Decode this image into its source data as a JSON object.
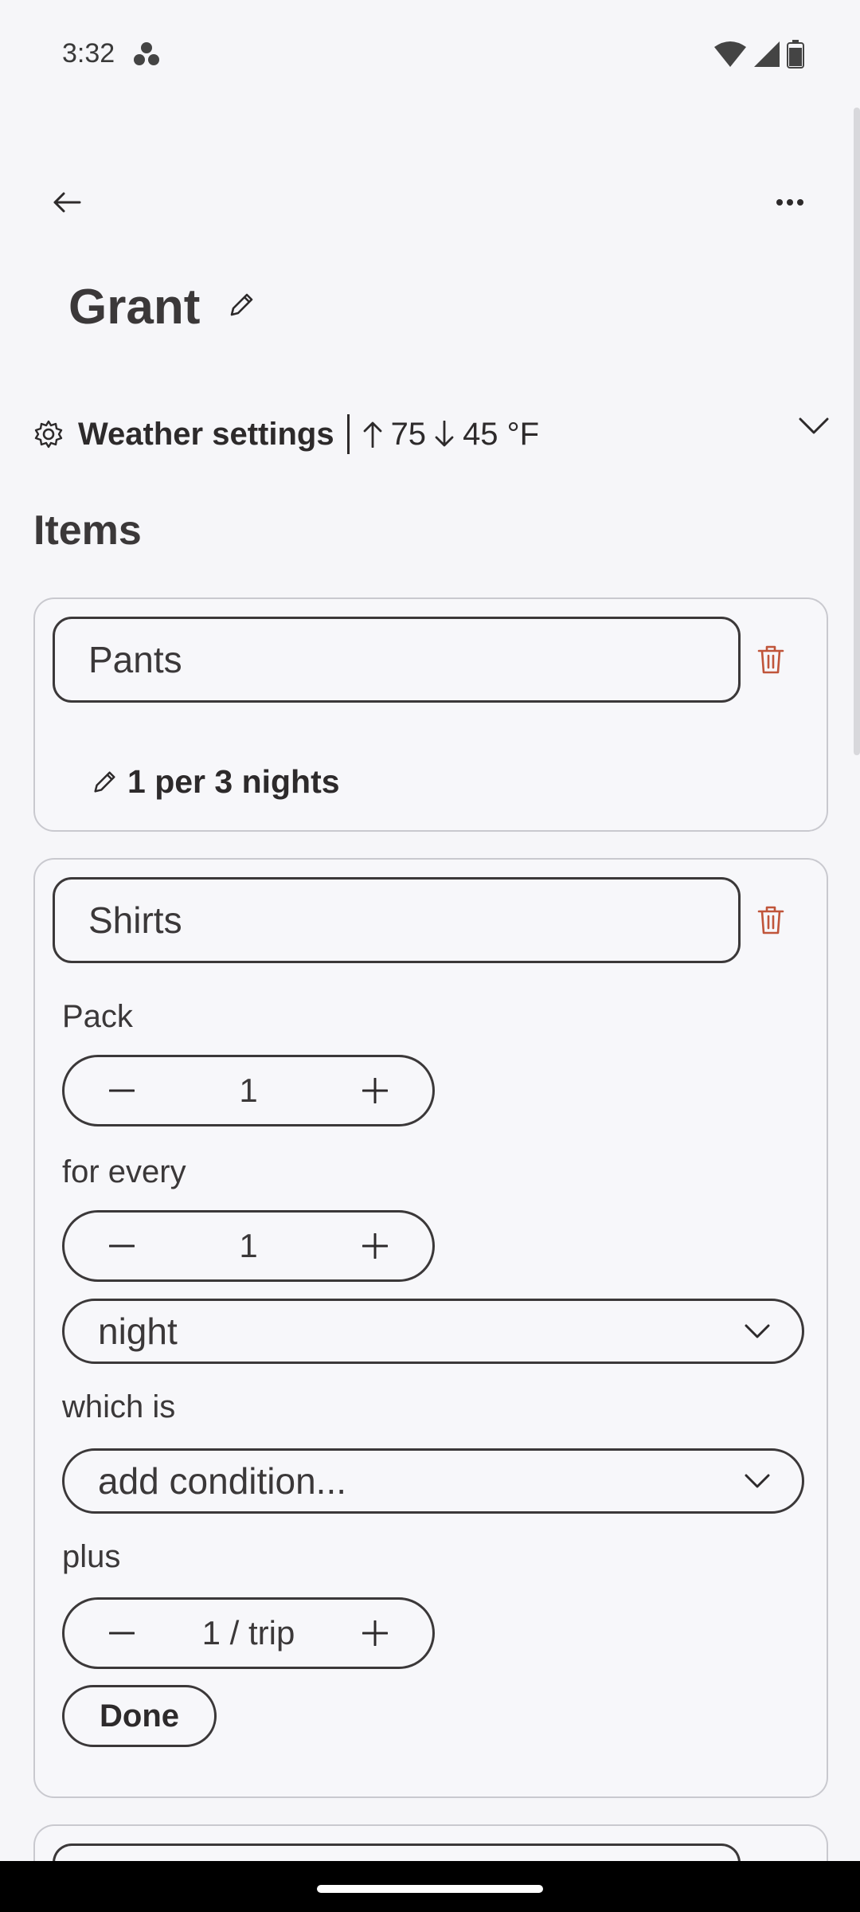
{
  "status_bar": {
    "time": "3:32"
  },
  "header": {
    "title": "Grant"
  },
  "weather": {
    "label": "Weather settings",
    "high": "75",
    "low": "45 °F"
  },
  "items_section": {
    "title": "Items"
  },
  "items": [
    {
      "name": "Pants",
      "summary": "1 per 3 nights"
    },
    {
      "name": "Shirts",
      "pack_label": "Pack",
      "pack_value": "1",
      "for_every_label": "for every",
      "for_every_value": "1",
      "period": "night",
      "which_is_label": "which is",
      "condition": "add condition...",
      "plus_label": "plus",
      "plus_value": "1 / trip",
      "done_label": "Done"
    }
  ],
  "colors": {
    "accent_trash": "#c0553a",
    "text": "#2d2a2b",
    "background": "#f6f6f9"
  }
}
